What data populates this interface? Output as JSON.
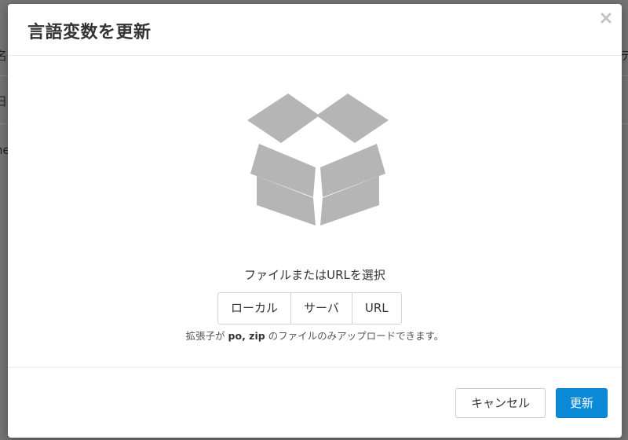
{
  "background": {
    "fragments": [
      "名",
      "日",
      "ne",
      "テ"
    ]
  },
  "modal": {
    "title": "言語変数を更新",
    "close_icon": "close-icon",
    "upload_icon": "open-box-icon",
    "prompt": "ファイルまたはURLを選択",
    "sources": [
      {
        "label": "ローカル"
      },
      {
        "label": "サーバ"
      },
      {
        "label": "URL"
      }
    ],
    "help": {
      "before": "拡張子が ",
      "extensions": "po, zip",
      "after": " のファイルのみアップロードできます。"
    },
    "footer": {
      "cancel_label": "キャンセル",
      "submit_label": "更新"
    }
  },
  "colors": {
    "primary": "#0b8ad8",
    "icon_gray": "#b5b5b5",
    "overlay": "#6e6e6e"
  }
}
